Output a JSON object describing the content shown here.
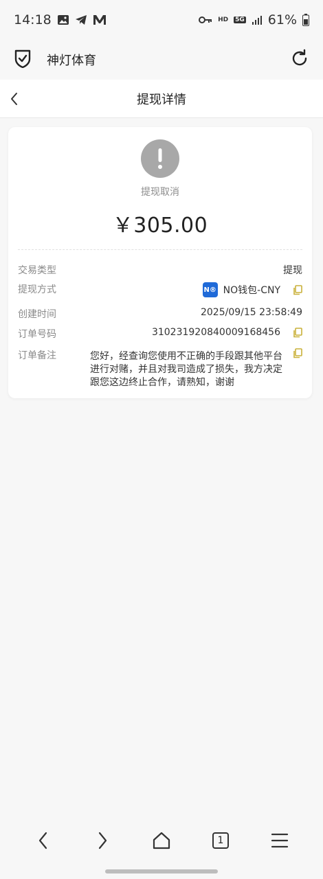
{
  "status_bar": {
    "time": "14:18",
    "battery": "61%",
    "hd_label": "HD",
    "network_label": "5G"
  },
  "browser": {
    "site_title": "神灯体育"
  },
  "page": {
    "title": "提现详情"
  },
  "withdrawal": {
    "status": "提现取消",
    "amount": "￥305.00",
    "rows": {
      "type_label": "交易类型",
      "type_value": "提现",
      "method_label": "提现方式",
      "method_badge": "N®",
      "method_value": "NO钱包-CNY",
      "created_label": "创建时间",
      "created_value": "2025/09/15 23:58:49",
      "order_label": "订单号码",
      "order_value": "310231920840009168456",
      "note_label": "订单备注",
      "note_value": "您好，经查询您使用不正确的手段跟其他平台进行对赌，并且对我司造成了损失，我方决定跟您这边终止合作，请熟知，谢谢"
    }
  },
  "bottom_nav": {
    "tab_count": "1"
  },
  "colors": {
    "status_gray": "#a8a8a8",
    "copy_icon": "#c9b13a",
    "badge_blue": "#1f6ad8"
  }
}
